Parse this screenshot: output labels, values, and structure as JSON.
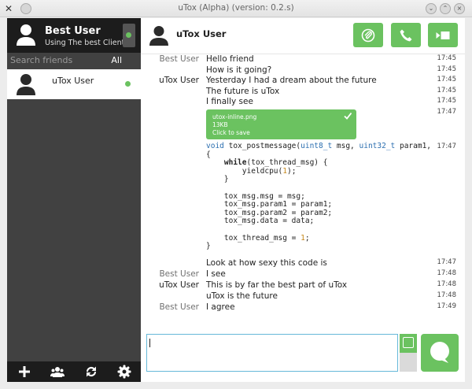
{
  "window": {
    "title": "uTox (Alpha) (version: 0.2.s)"
  },
  "self": {
    "name": "Best User",
    "status_message": "Using The best Client",
    "status": "online"
  },
  "search": {
    "placeholder": "Search friends",
    "filter_label": "All"
  },
  "friends": [
    {
      "name": "uTox User",
      "status": "online"
    }
  ],
  "sidebar_toolbar": [
    "add-icon",
    "group-icon",
    "transfer-icon",
    "settings-icon"
  ],
  "header": {
    "contact_name": "uTox User",
    "buttons": [
      "attach-icon",
      "call-icon",
      "video-icon"
    ]
  },
  "messages": [
    {
      "author": "Best User",
      "text": "Hello friend",
      "time": "17:45"
    },
    {
      "author": "",
      "text": "How is it going?",
      "time": "17:45"
    },
    {
      "author": "uTox User",
      "text": "Yesterday I had a dream about the future",
      "time": "17:45"
    },
    {
      "author": "",
      "text": "The future is uTox",
      "time": "17:45"
    },
    {
      "author": "",
      "text": "I finally see",
      "time": "17:45"
    },
    {
      "author": "",
      "text": "",
      "time": "17:47"
    },
    {
      "author": "",
      "text": "",
      "time": "17:47"
    },
    {
      "author": "",
      "text": "Look at how sexy this code is",
      "time": "17:47"
    },
    {
      "author": "Best User",
      "text": "I see",
      "time": "17:48"
    },
    {
      "author": "uTox User",
      "text": "This is by far the best part of uTox",
      "time": "17:48"
    },
    {
      "author": "",
      "text": "uTox is the future",
      "time": "17:48"
    },
    {
      "author": "Best User",
      "text": "I agree",
      "time": "17:49"
    }
  ],
  "file_transfer": {
    "filename": "utox-inline.png",
    "size": "13KB",
    "hint": "Click to save"
  },
  "code_snippet": "void tox_postmessage(uint8_t msg, uint32_t param1,\n{\n    while(tox_thread_msg) {\n        yieldcpu(1);\n    }\n\n    tox_msg.msg = msg;\n    tox_msg.param1 = param1;\n    tox_msg.param2 = param2;\n    tox_msg.data = data;\n\n    tox_thread_msg = 1;\n}",
  "composer": {
    "value": ""
  },
  "colors": {
    "accent": "#6bc260",
    "sidebar_bg": "#414141",
    "sidebar_dark": "#1c1c1c",
    "input_border": "#66b8d9"
  }
}
